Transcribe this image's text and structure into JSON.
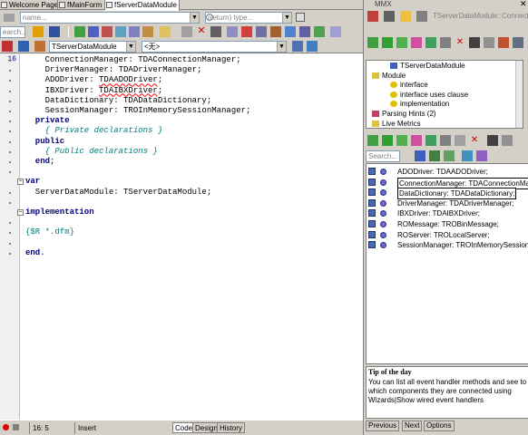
{
  "tabs": [
    "Welcome Page",
    "fMainForm",
    "fServerDataModule"
  ],
  "search": {
    "name_placeholder": "name...",
    "return_placeholder": "(return) type...",
    "search_placeholder": "earch..."
  },
  "editor_toolbar": {
    "unit_combo": "TServerDataModule",
    "none_combo": "<无>"
  },
  "code": {
    "line_number": "16",
    "lines": [
      {
        "t": "    ConnectionManager: TDAConnectionManager;"
      },
      {
        "t": "    DriverManager: TDADriverManager;"
      },
      {
        "t": "    ADODriver: ",
        "sq": "TDAADODriver",
        "rest": ";"
      },
      {
        "t": "    IBXDriver: ",
        "sq": "TDAIBXDriver",
        "rest": ";"
      },
      {
        "t": "    DataDictionary: TDADataDictionary;"
      },
      {
        "t": "    SessionManager: TROInMemorySessionManager;"
      },
      {
        "kw": "  private"
      },
      {
        "cm": "    { Private declarations }"
      },
      {
        "kw": "  public"
      },
      {
        "cm": "    { Public declarations }"
      },
      {
        "kw": "  end",
        "rest": ";"
      },
      {
        "blank": true
      },
      {
        "kw": "var"
      },
      {
        "t": "  ServerDataModule: TServerDataModule;"
      },
      {
        "blank": true
      },
      {
        "kw": "implementation"
      },
      {
        "blank": true
      },
      {
        "dir": "{$R *.dfm}"
      },
      {
        "blank": true
      },
      {
        "kw": "end",
        "rest": "."
      }
    ]
  },
  "status": {
    "position": "16:  5",
    "mode": "Insert",
    "views": [
      "Code",
      "Design",
      "History"
    ]
  },
  "mmx": {
    "title": "MMX",
    "breadcrumb": "TServerDataModule::Connect...",
    "tree": [
      {
        "label": "TServerDataModule",
        "indent": 2,
        "icon": "class"
      },
      {
        "label": "Module",
        "indent": 0,
        "icon": "folder"
      },
      {
        "label": "interface",
        "indent": 2,
        "icon": "unit"
      },
      {
        "label": "interface uses clause",
        "indent": 2,
        "icon": "unit"
      },
      {
        "label": "implementation",
        "indent": 2,
        "icon": "unit"
      },
      {
        "label": "Parsing Hints (2)",
        "indent": 0,
        "icon": "hint"
      },
      {
        "label": "Live Metrics",
        "indent": 0,
        "icon": "folder"
      }
    ],
    "members_search_placeholder": "Search...",
    "members": [
      {
        "label": "ADODriver: TDAADODriver;",
        "boxed": false
      },
      {
        "label": "ConnectionManager: TDAConnectionManager",
        "boxed": true
      },
      {
        "label": "DataDictionary: TDADataDictionary;",
        "boxed": true
      },
      {
        "label": "DriverManager: TDADriverManager;",
        "boxed": false
      },
      {
        "label": "IBXDriver: TDAIBXDriver;",
        "boxed": false
      },
      {
        "label": "ROMessage: TROBinMessage;",
        "boxed": false
      },
      {
        "label": "ROServer: TROLocalServer;",
        "boxed": false
      },
      {
        "label": "SessionManager: TROInMemorySessionManager",
        "boxed": false
      }
    ]
  },
  "tip": {
    "title": "Tip of the day",
    "text": "You can list all event handler methods and see to which components they are connected using Wizards|Show wired event handlers",
    "buttons": [
      "Previous",
      "Next",
      "Options"
    ]
  },
  "colors": {
    "keyword": "#000080",
    "comment": "#008080",
    "squiggle": "#ff0000"
  }
}
